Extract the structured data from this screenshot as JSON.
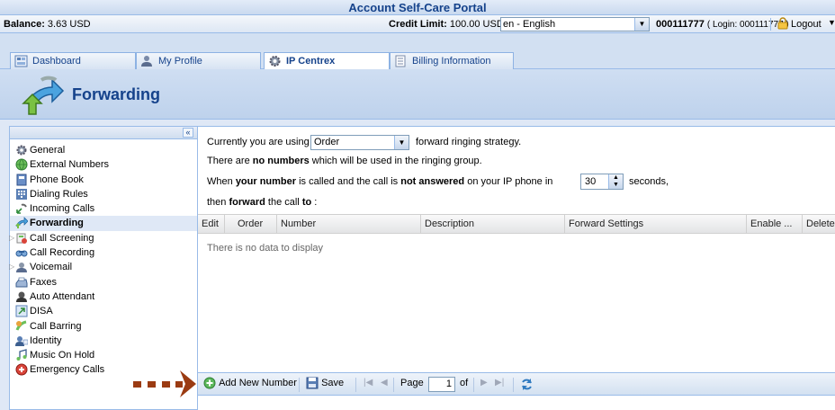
{
  "header": {
    "title": "Account Self-Care Portal"
  },
  "infobar": {
    "balance_label": "Balance:",
    "balance_value": "3.63 USD",
    "credit_label": "Credit Limit:",
    "credit_value": "100.00 USD",
    "language": "en - English",
    "account_id": "000111777",
    "account_login": "( Login: 000111777 )",
    "logout": "Logout"
  },
  "tabs": [
    {
      "label": "Dashboard",
      "icon": "dashboard-icon"
    },
    {
      "label": "My Profile",
      "icon": "user-icon"
    },
    {
      "label": "IP Centrex",
      "icon": "gear-icon",
      "active": true
    },
    {
      "label": "Billing Information",
      "icon": "document-icon"
    }
  ],
  "page": {
    "title": "Forwarding"
  },
  "sidebar": {
    "items": [
      {
        "label": "General"
      },
      {
        "label": "External Numbers"
      },
      {
        "label": "Phone Book"
      },
      {
        "label": "Dialing Rules"
      },
      {
        "label": "Incoming Calls"
      },
      {
        "label": "Forwarding",
        "selected": true
      },
      {
        "label": "Call Screening",
        "expandable": true
      },
      {
        "label": "Call Recording"
      },
      {
        "label": "Voicemail",
        "expandable": true
      },
      {
        "label": "Faxes"
      },
      {
        "label": "Auto Attendant"
      },
      {
        "label": "DISA"
      },
      {
        "label": "Call Barring"
      },
      {
        "label": "Identity"
      },
      {
        "label": "Music On Hold"
      },
      {
        "label": "Emergency Calls"
      }
    ]
  },
  "main": {
    "line1_pre": "Currently you are using",
    "strategy_value": "Order",
    "line1_post": "forward ringing strategy.",
    "line2_pre": "There are",
    "line2_bold": "no numbers",
    "line2_post": "which will be used in the ringing group.",
    "line3_a": "When",
    "line3_b": "your number",
    "line3_c": "is called and the call is",
    "line3_d": "not answered",
    "line3_e": "on your IP phone in",
    "seconds_value": "30",
    "seconds_label": "seconds,",
    "line4_a": "then",
    "line4_b": "forward",
    "line4_c": "the call",
    "line4_d": "to",
    "line4_e": ":"
  },
  "grid": {
    "columns": [
      "Edit",
      "Order",
      "Number",
      "Description",
      "Forward Settings",
      "Enable ...",
      "Delete"
    ],
    "empty_text": "There is no data to display"
  },
  "toolbar": {
    "add_label": "Add New Number",
    "save_label": "Save",
    "page_label": "Page",
    "page_value": "1",
    "of_label": "of"
  }
}
